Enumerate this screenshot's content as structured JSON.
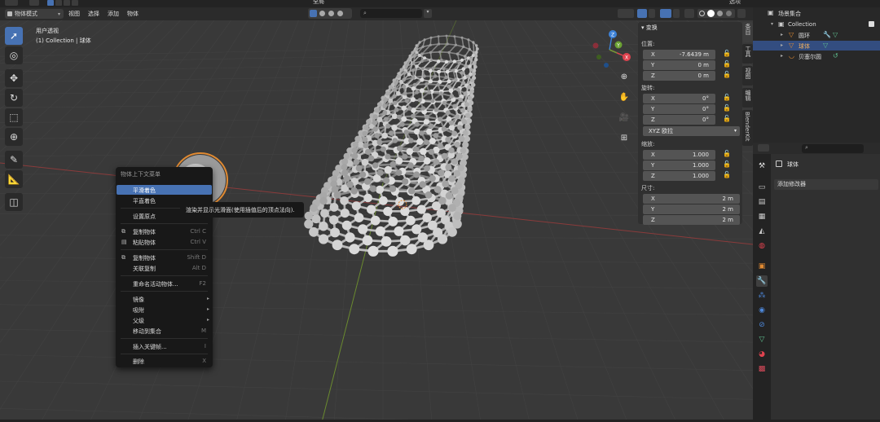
{
  "header": {
    "mode_label": "物体模式",
    "menus": [
      "视图",
      "选择",
      "添加",
      "物体"
    ],
    "transform_orientation": "全局",
    "options_label": "选项"
  },
  "viewport": {
    "view_name": "用户透视",
    "collection_info": "(1) Collection | 球体"
  },
  "gizmo": {
    "z": "Z",
    "y": "Y",
    "x": "X"
  },
  "npanel": {
    "title": "变换",
    "location_label": "位置:",
    "location": {
      "x": "-7.6439 m",
      "y": "0 m",
      "z": "0 m"
    },
    "rotation_label": "旋转:",
    "rotation": {
      "x": "0°",
      "y": "0°",
      "z": "0°"
    },
    "rotation_mode": "XYZ 欧拉",
    "scale_label": "缩放:",
    "scale": {
      "x": "1.000",
      "y": "1.000",
      "z": "1.000"
    },
    "dimensions_label": "尺寸:",
    "dimensions": {
      "x": "2 m",
      "y": "2 m",
      "z": "2 m"
    },
    "axis": {
      "x": "X",
      "y": "Y",
      "z": "Z"
    }
  },
  "side_tabs": [
    "条目",
    "工具",
    "视图",
    "编辑",
    "BlenderKit"
  ],
  "context_menu": {
    "title": "物体上下文菜单",
    "items": [
      {
        "label": "平滑着色",
        "shortcut": ""
      },
      {
        "label": "平直着色",
        "shortcut": ""
      },
      {
        "label": "设置原点",
        "shortcut": ""
      },
      {
        "label": "复制物体",
        "shortcut": "Ctrl C"
      },
      {
        "label": "粘贴物体",
        "shortcut": "Ctrl V"
      },
      {
        "label": "复制物体",
        "shortcut": "Shift D"
      },
      {
        "label": "关联复制",
        "shortcut": "Alt D"
      },
      {
        "label": "重命名活动物体...",
        "shortcut": "F2"
      },
      {
        "label": "镜像",
        "shortcut": ""
      },
      {
        "label": "吸附",
        "shortcut": ""
      },
      {
        "label": "父级",
        "shortcut": ""
      },
      {
        "label": "移动到集合",
        "shortcut": "M"
      },
      {
        "label": "插入关键帧...",
        "shortcut": "I"
      },
      {
        "label": "删除",
        "shortcut": "X"
      }
    ]
  },
  "tooltip": "渲染并显示光滑面(使用插值后的顶点法向).",
  "outliner": {
    "scene_collection": "场景集合",
    "collection": "Collection",
    "objects": [
      "圆环",
      "球体",
      "贝塞尔圆"
    ]
  },
  "properties": {
    "object_name": "球体",
    "add_modifier": "添加修改器"
  },
  "colors": {
    "accent": "#4772b3",
    "axis_x": "#e0434f",
    "axis_y": "#6ba233",
    "axis_z": "#3d82d8",
    "modifier_icon": "#4d87d9",
    "mesh_icon": "#5fbf8f",
    "object_icon": "#e08a32"
  }
}
